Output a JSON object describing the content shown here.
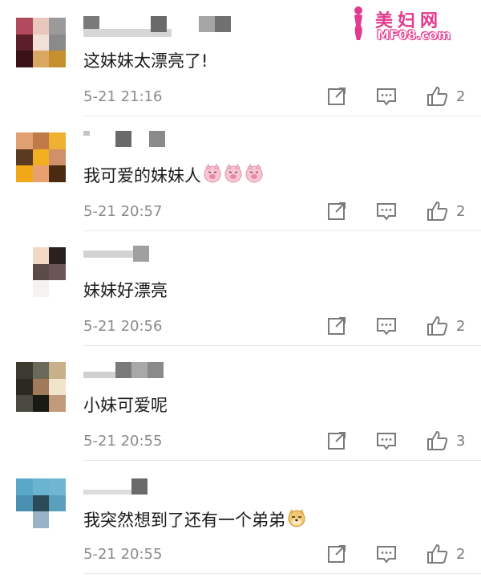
{
  "watermark": {
    "cn": "美妇网",
    "en": "MF08.com"
  },
  "colors": {
    "meta": "#8a8a8a",
    "divider": "#e8e8e8",
    "watermark": "#e23b8d"
  },
  "comments": [
    {
      "text": "这妹妹太漂亮了!",
      "time": "5-21 21:16",
      "likes": "2",
      "emoji": ""
    },
    {
      "text": "我可爱的妹妹人",
      "time": "5-21 20:57",
      "likes": "2",
      "emoji": "pig-face-x3"
    },
    {
      "text": "妹妹好漂亮",
      "time": "5-21 20:56",
      "likes": "2",
      "emoji": ""
    },
    {
      "text": "小妹可爱呢",
      "time": "5-21 20:55",
      "likes": "3",
      "emoji": ""
    },
    {
      "text": "我突然想到了还有一个弟弟",
      "time": "5-21 20:55",
      "likes": "2",
      "emoji": "doge-face"
    }
  ],
  "icons": {
    "share": "share-icon",
    "reply": "comment-icon",
    "like": "thumbs-up-icon"
  }
}
